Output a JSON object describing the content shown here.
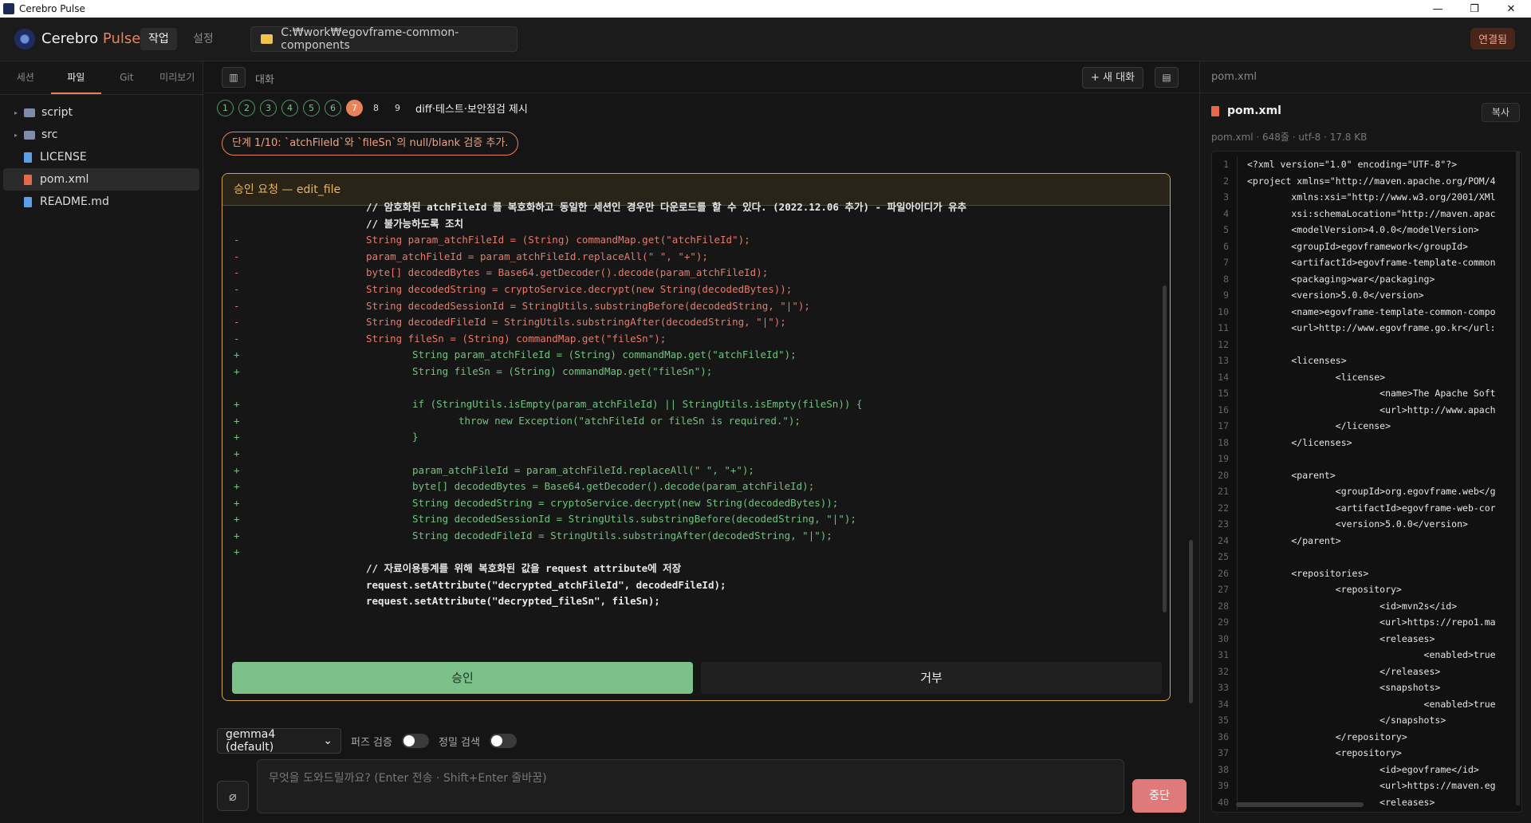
{
  "window": {
    "title": "Cerebro Pulse",
    "controls": [
      "—",
      "❐",
      "✕"
    ]
  },
  "header": {
    "brand_main": "Cerebro",
    "brand_accent": "Pulse",
    "tabs": [
      {
        "label": "작업"
      },
      {
        "label": "설정"
      }
    ],
    "path": "C:₩work₩egovframe-common-components",
    "status": "연결됨"
  },
  "left": {
    "tabs": [
      "세션",
      "파일",
      "Git",
      "미리보기"
    ],
    "tree": [
      {
        "type": "folder",
        "name": "script"
      },
      {
        "type": "folder",
        "name": "src"
      },
      {
        "type": "file",
        "name": "LICENSE"
      },
      {
        "type": "file",
        "name": "pom.xml"
      },
      {
        "type": "file",
        "name": "README.md"
      }
    ]
  },
  "center": {
    "conversation_label": "대화",
    "new_conversation": "+ 새 대화",
    "steps": [
      "1",
      "2",
      "3",
      "4",
      "5",
      "6",
      "7",
      "8",
      "9"
    ],
    "step_title": "diff·테스트·보안점검 제시",
    "step_hint": "단계 1/10: `atchFileId`와 `fileSn`의 null/blank 검증 추가.",
    "approval": {
      "title": "승인 요청 — edit_file",
      "lines": [
        {
          "sign": " ",
          "kind": "ctx",
          "indent": 0,
          "text": "// 암호화된 atchFileId 를 복호화하고 동일한 세션인 경우만 다운로드를 할 수 있다. (2022.12.06 추가) - 파일아이디가 유추"
        },
        {
          "sign": " ",
          "kind": "ctx",
          "indent": 0,
          "text": "// 불가능하도록 조치"
        },
        {
          "sign": "-",
          "kind": "del",
          "indent": 0,
          "text": "String param_atchFileId = (String) commandMap.get(\"atchFileId\");"
        },
        {
          "sign": "-",
          "kind": "del",
          "indent": 0,
          "text": "param_atchFileId = param_atchFileId.replaceAll(\" \", \"+\");"
        },
        {
          "sign": "-",
          "kind": "del",
          "indent": 0,
          "text": "byte[] decodedBytes = Base64.getDecoder().decode(param_atchFileId);"
        },
        {
          "sign": "-",
          "kind": "del",
          "indent": 0,
          "text": "String decodedString = cryptoService.decrypt(new String(decodedBytes));"
        },
        {
          "sign": "-",
          "kind": "del",
          "indent": 0,
          "text": "String decodedSessionId = StringUtils.substringBefore(decodedString, \"|\");"
        },
        {
          "sign": "-",
          "kind": "del",
          "indent": 0,
          "text": "String decodedFileId = StringUtils.substringAfter(decodedString, \"|\");"
        },
        {
          "sign": "-",
          "kind": "del",
          "indent": 0,
          "text": "String fileSn = (String) commandMap.get(\"fileSn\");"
        },
        {
          "sign": "+",
          "kind": "add",
          "indent": 1,
          "text": "String param_atchFileId = (String) commandMap.get(\"atchFileId\");"
        },
        {
          "sign": "+",
          "kind": "add",
          "indent": 1,
          "text": "String fileSn = (String) commandMap.get(\"fileSn\");"
        },
        {
          "sign": " ",
          "kind": "add",
          "indent": 1,
          "text": ""
        },
        {
          "sign": "+",
          "kind": "add",
          "indent": 1,
          "text": "if (StringUtils.isEmpty(param_atchFileId) || StringUtils.isEmpty(fileSn)) {"
        },
        {
          "sign": "+",
          "kind": "add",
          "indent": 2,
          "text": "throw new Exception(\"atchFileId or fileSn is required.\");"
        },
        {
          "sign": "+",
          "kind": "add",
          "indent": 1,
          "text": "}"
        },
        {
          "sign": "+",
          "kind": "add",
          "indent": 1,
          "text": ""
        },
        {
          "sign": "+",
          "kind": "add",
          "indent": 1,
          "text": "param_atchFileId = param_atchFileId.replaceAll(\" \", \"+\");"
        },
        {
          "sign": "+",
          "kind": "add",
          "indent": 1,
          "text": "byte[] decodedBytes = Base64.getDecoder().decode(param_atchFileId);"
        },
        {
          "sign": "+",
          "kind": "add",
          "indent": 1,
          "text": "String decodedString = cryptoService.decrypt(new String(decodedBytes));"
        },
        {
          "sign": "+",
          "kind": "add",
          "indent": 1,
          "text": "String decodedSessionId = StringUtils.substringBefore(decodedString, \"|\");"
        },
        {
          "sign": "+",
          "kind": "add",
          "indent": 1,
          "text": "String decodedFileId = StringUtils.substringAfter(decodedString, \"|\");"
        },
        {
          "sign": "+",
          "kind": "add",
          "indent": 1,
          "text": ""
        },
        {
          "sign": " ",
          "kind": "ctx",
          "indent": 0,
          "text": "// 자료이용통계를 위해 복호화된 값을 request attribute에 저장"
        },
        {
          "sign": " ",
          "kind": "ctx",
          "indent": 0,
          "text": "request.setAttribute(\"decrypted_atchFileId\", decodedFileId);"
        },
        {
          "sign": " ",
          "kind": "ctx",
          "indent": 0,
          "text": "request.setAttribute(\"decrypted_fileSn\", fileSn);"
        }
      ],
      "approve_label": "승인",
      "reject_label": "거부"
    },
    "model": "gemma4 (default)",
    "fuzzy_label": "퍼즈 검증",
    "precise_label": "정밀 검색",
    "prompt_placeholder": "무엇을 도와드릴까요? (Enter 전송 · Shift+Enter 줄바꿈)",
    "stop_label": "중단"
  },
  "right": {
    "header": "pom.xml",
    "file_name": "pom.xml",
    "copy_label": "복사",
    "meta": "pom.xml · 648줄 · utf-8 · 17.8 KB",
    "code": [
      {
        "n": "1",
        "t": "<?xml version=\"1.0\" encoding=\"UTF-8\"?>"
      },
      {
        "n": "2",
        "t": "<project xmlns=\"http://maven.apache.org/POM/4"
      },
      {
        "n": "3",
        "t": "        xmlns:xsi=\"http://www.w3.org/2001/XMl"
      },
      {
        "n": "4",
        "t": "        xsi:schemaLocation=\"http://maven.apac"
      },
      {
        "n": "5",
        "t": "        <modelVersion>4.0.0</modelVersion>"
      },
      {
        "n": "6",
        "t": "        <groupId>egovframework</groupId>"
      },
      {
        "n": "7",
        "t": "        <artifactId>egovframe-template-common"
      },
      {
        "n": "8",
        "t": "        <packaging>war</packaging>"
      },
      {
        "n": "9",
        "t": "        <version>5.0.0</version>"
      },
      {
        "n": "10",
        "t": "        <name>egovframe-template-common-compo"
      },
      {
        "n": "11",
        "t": "        <url>http://www.egovframe.go.kr</url:"
      },
      {
        "n": "12",
        "t": ""
      },
      {
        "n": "13",
        "t": "        <licenses>"
      },
      {
        "n": "14",
        "t": "                <license>"
      },
      {
        "n": "15",
        "t": "                        <name>The Apache Soft"
      },
      {
        "n": "16",
        "t": "                        <url>http://www.apach"
      },
      {
        "n": "17",
        "t": "                </license>"
      },
      {
        "n": "18",
        "t": "        </licenses>"
      },
      {
        "n": "19",
        "t": ""
      },
      {
        "n": "20",
        "t": "        <parent>"
      },
      {
        "n": "21",
        "t": "                <groupId>org.egovframe.web</g"
      },
      {
        "n": "22",
        "t": "                <artifactId>egovframe-web-cor"
      },
      {
        "n": "23",
        "t": "                <version>5.0.0</version>"
      },
      {
        "n": "24",
        "t": "        </parent>"
      },
      {
        "n": "25",
        "t": ""
      },
      {
        "n": "26",
        "t": "        <repositories>"
      },
      {
        "n": "27",
        "t": "                <repository>"
      },
      {
        "n": "28",
        "t": "                        <id>mvn2s</id>"
      },
      {
        "n": "29",
        "t": "                        <url>https://repo1.ma"
      },
      {
        "n": "30",
        "t": "                        <releases>"
      },
      {
        "n": "31",
        "t": "                                <enabled>true"
      },
      {
        "n": "32",
        "t": "                        </releases>"
      },
      {
        "n": "33",
        "t": "                        <snapshots>"
      },
      {
        "n": "34",
        "t": "                                <enabled>true"
      },
      {
        "n": "35",
        "t": "                        </snapshots>"
      },
      {
        "n": "36",
        "t": "                </repository>"
      },
      {
        "n": "37",
        "t": "                <repository>"
      },
      {
        "n": "38",
        "t": "                        <id>egovframe</id>"
      },
      {
        "n": "39",
        "t": "                        <url>https://maven.eg"
      },
      {
        "n": "40",
        "t": "                        <releases>"
      }
    ]
  }
}
